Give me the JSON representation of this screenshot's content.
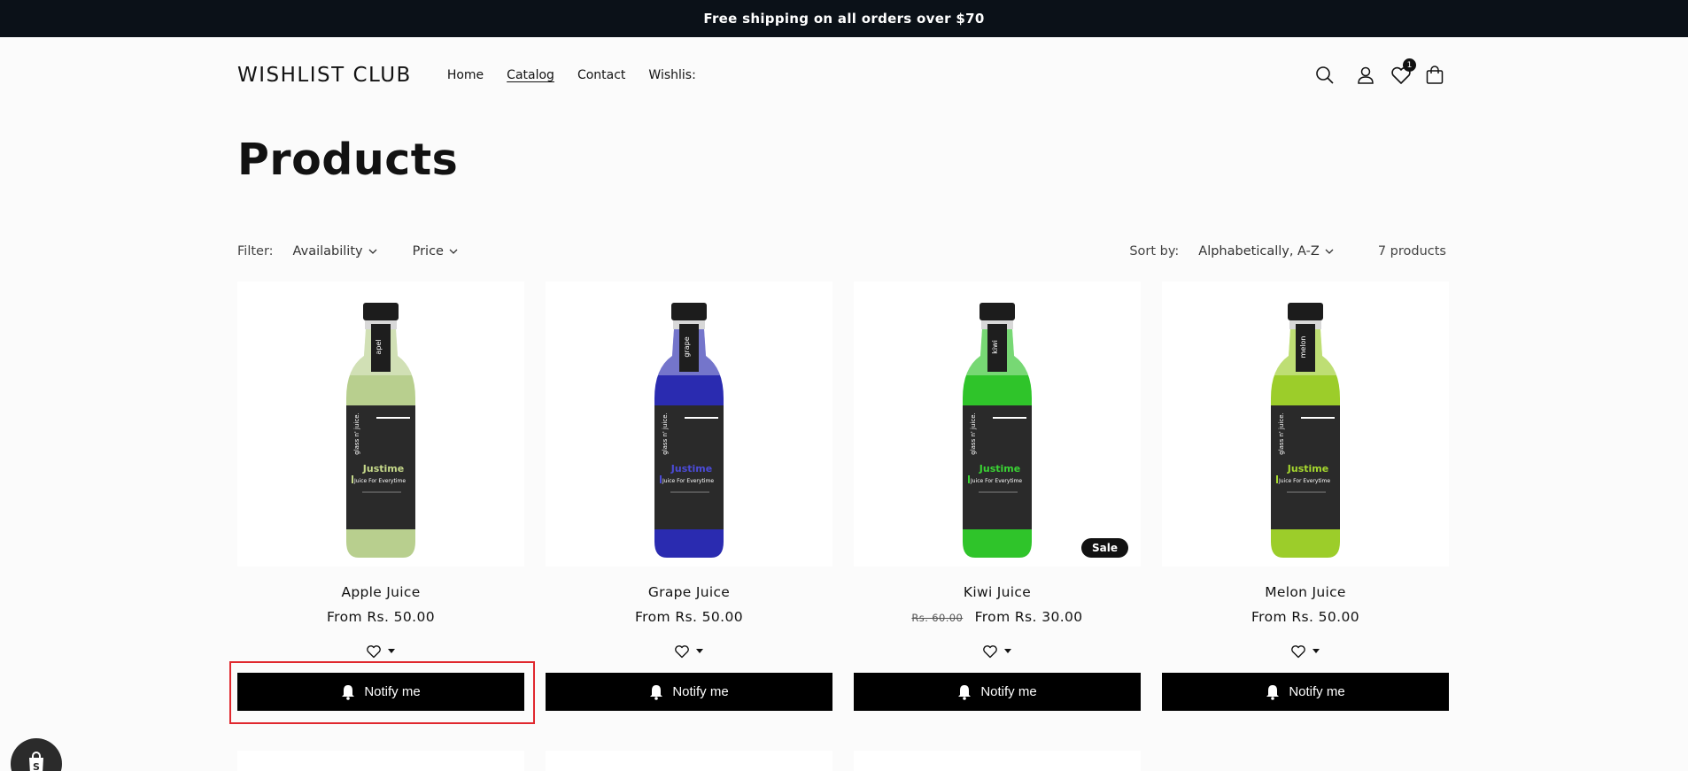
{
  "announcement": "Free shipping on all orders over $70",
  "header": {
    "logo": "WISHLIST CLUB",
    "nav": [
      {
        "label": "Home"
      },
      {
        "label": "Catalog"
      },
      {
        "label": "Contact"
      },
      {
        "label": "Wishlis:"
      }
    ],
    "wishlist_count": "1"
  },
  "page_title": "Products",
  "filters": {
    "filter_label": "Filter:",
    "availability": "Availability",
    "price": "Price",
    "sort_label": "Sort by:",
    "sort_value": "Alphabetically, A-Z",
    "count": "7 products"
  },
  "products": [
    {
      "name": "Apple Juice",
      "price": "From Rs. 50.00",
      "old_price": "",
      "color": "#b8cf8e",
      "label": "apel",
      "accent": "#c6d98a",
      "sale": ""
    },
    {
      "name": "Grape Juice",
      "price": "From Rs. 50.00",
      "old_price": "",
      "color": "#2a2bb0",
      "label": "grape",
      "accent": "#4b4bd8",
      "sale": ""
    },
    {
      "name": "Kiwi Juice",
      "price": "From Rs. 30.00",
      "old_price": "Rs. 60.00",
      "color": "#2fc42a",
      "label": "kiwi",
      "accent": "#3ad434",
      "sale": "Sale"
    },
    {
      "name": "Melon Juice",
      "price": "From Rs. 50.00",
      "old_price": "",
      "color": "#9ccd2a",
      "label": "melon",
      "accent": "#a6d82e",
      "sale": ""
    }
  ],
  "bottle_text": {
    "brand": "Justime",
    "tagline": "Juice For Everytime",
    "maker": "glass n' juice."
  },
  "notify_label": "Notify me"
}
